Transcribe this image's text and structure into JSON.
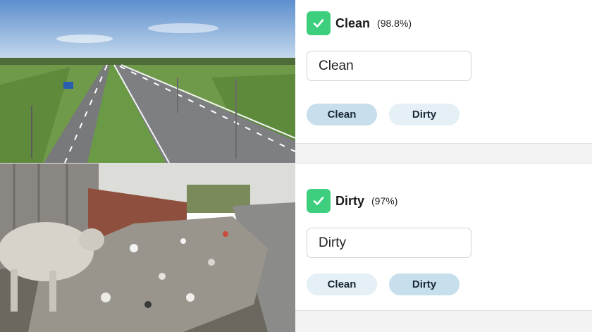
{
  "cards": [
    {
      "prediction": {
        "label": "Clean",
        "confidence": "(98.8%)"
      },
      "input_value": "Clean",
      "options": [
        "Clean",
        "Dirty"
      ],
      "selected": "Clean"
    },
    {
      "prediction": {
        "label": "Dirty",
        "confidence": "(97%)"
      },
      "input_value": "Dirty",
      "options": [
        "Clean",
        "Dirty"
      ],
      "selected": "Dirty"
    }
  ],
  "colors": {
    "check_green": "#3ecf7e",
    "chip_bg": "#e4eff6",
    "chip_selected_bg": "#c7deec"
  },
  "icons": {
    "check": "checkmark-icon"
  }
}
